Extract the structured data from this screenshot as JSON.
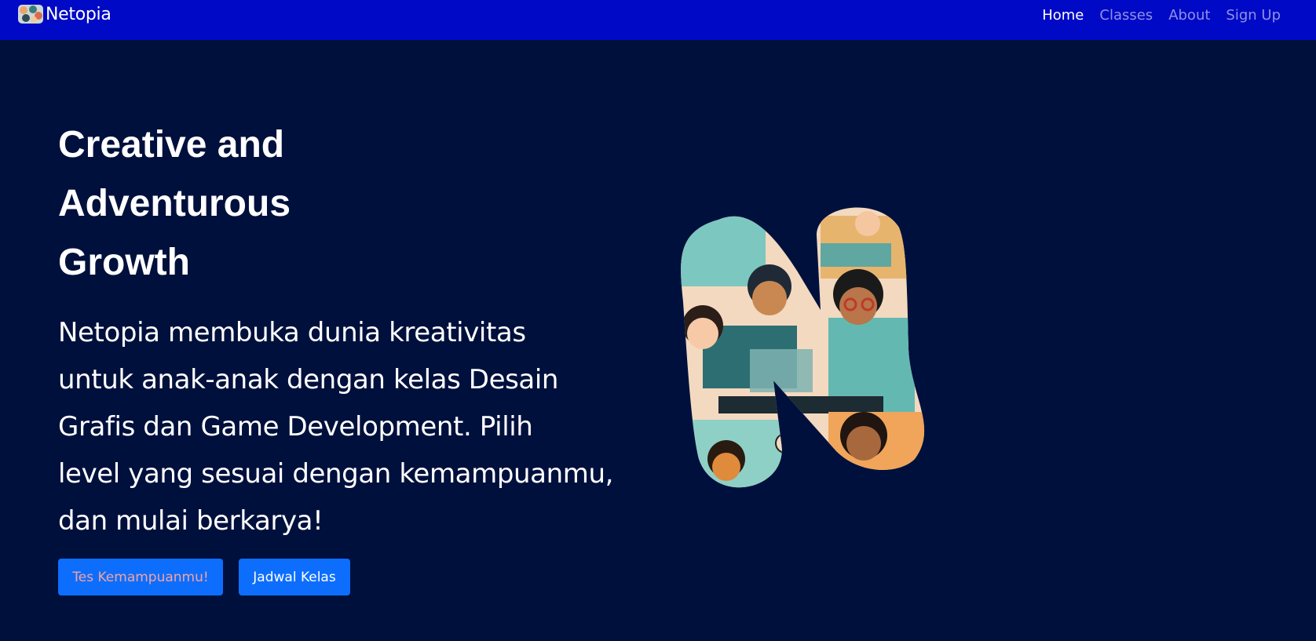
{
  "nav": {
    "brand": "Netopia",
    "logo_icon": "netopia-logo-icon",
    "links": [
      {
        "label": "Home",
        "active": true
      },
      {
        "label": "Classes",
        "active": false
      },
      {
        "label": "About",
        "active": false
      },
      {
        "label": "Sign Up",
        "active": false
      }
    ]
  },
  "hero": {
    "title_lines": [
      "Creative and",
      "Adventurous",
      "Growth"
    ],
    "description_lines": [
      "Netopia membuka dunia kreativitas",
      "untuk anak-anak dengan kelas Desain",
      "Grafis dan Game Development. Pilih",
      "level yang sesuai dengan kemampuanmu,",
      "dan mulai berkarya!"
    ],
    "primary_button": "Tes Kemampuanmu!",
    "secondary_button": "Jadwal Kelas",
    "image_icon": "netopia-n-illustration"
  },
  "colors": {
    "navbar_bg": "#0009c6",
    "page_bg": "#00103c",
    "button_bg": "#0d6efd",
    "primary_button_text": "#f4a3a0"
  }
}
